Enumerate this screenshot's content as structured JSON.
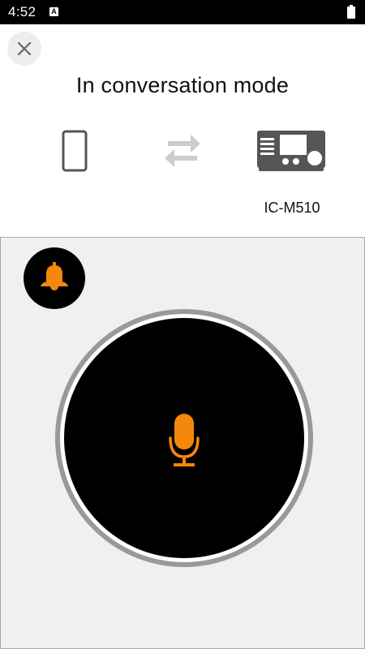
{
  "status_bar": {
    "time": "4:52",
    "notification_badge": "A",
    "icons": [
      "a-notification-icon",
      "battery-icon"
    ]
  },
  "header": {
    "close_icon": "close-icon",
    "title": "In conversation mode",
    "left_device_icon": "smartphone-icon",
    "link_icon": "transfer-arrows-icon",
    "right_device_icon": "marine-radio-icon",
    "right_device_label": "IC-M510"
  },
  "controls": {
    "bell_icon": "bell-icon",
    "ptt_icon": "microphone-icon"
  },
  "colors": {
    "accent": "#f5870a",
    "status_bar": "#000000",
    "panel_background": "#f0f0f0",
    "ptt_button": "#000000",
    "ptt_ring": "#999999",
    "device_icons": "#555555",
    "link_arrows": "#cccccc"
  }
}
